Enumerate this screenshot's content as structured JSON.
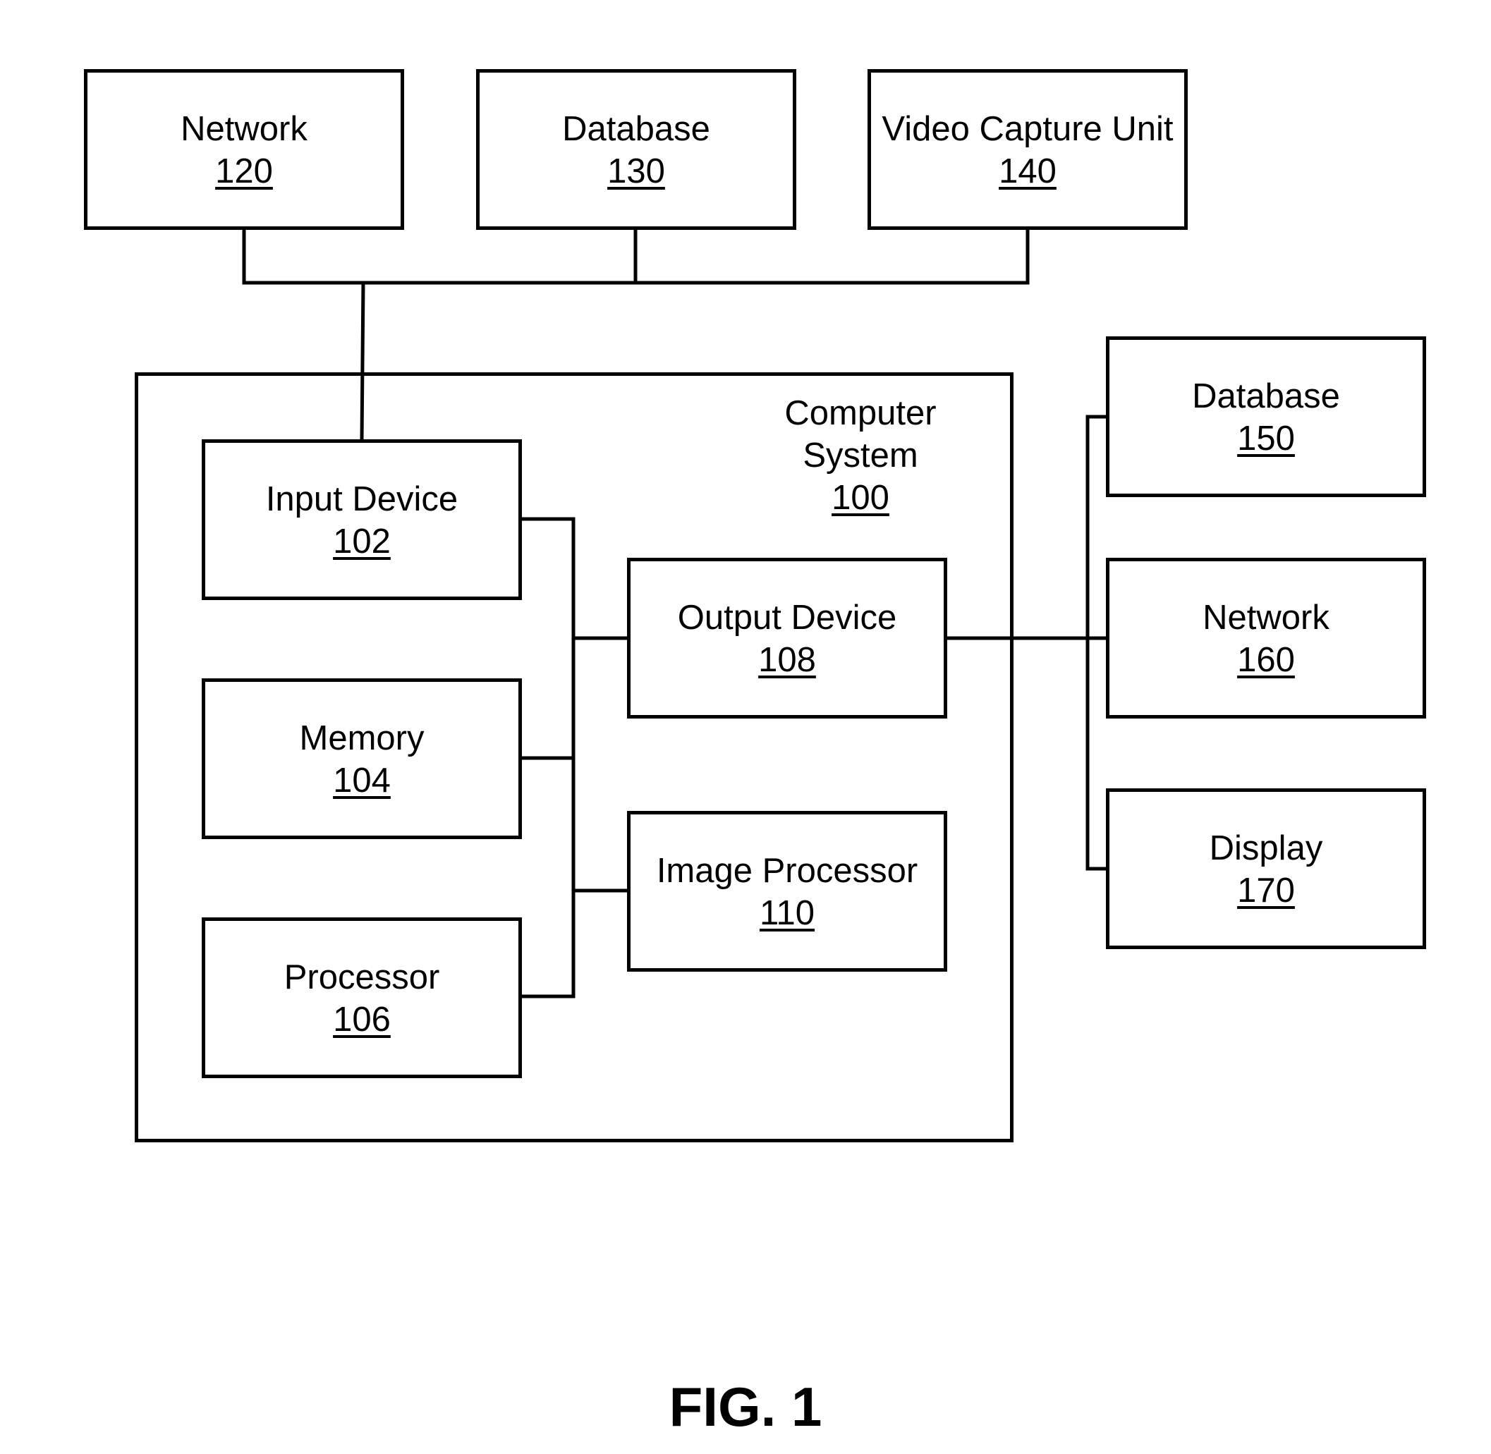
{
  "figure": {
    "caption": "FIG. 1",
    "external_top": [
      {
        "name": "Network",
        "ref": "120"
      },
      {
        "name": "Database",
        "ref": "130"
      },
      {
        "name": "Video Capture Unit",
        "ref": "140"
      }
    ],
    "computer_system": {
      "name_line1": "Computer",
      "name_line2": "System",
      "ref": "100",
      "components": [
        {
          "name": "Input Device",
          "ref": "102"
        },
        {
          "name": "Memory",
          "ref": "104"
        },
        {
          "name": "Processor",
          "ref": "106"
        },
        {
          "name": "Output Device",
          "ref": "108"
        },
        {
          "name": "Image Processor",
          "ref": "110"
        }
      ]
    },
    "external_right": [
      {
        "name": "Database",
        "ref": "150"
      },
      {
        "name": "Network",
        "ref": "160"
      },
      {
        "name": "Display",
        "ref": "170"
      }
    ]
  }
}
